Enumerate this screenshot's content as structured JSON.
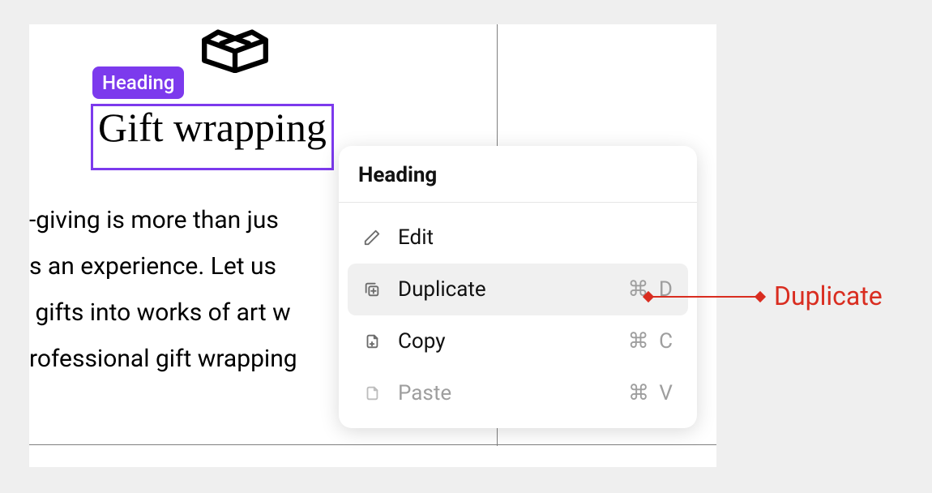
{
  "badge_label": "Heading",
  "heading_text": "Gift wrapping",
  "paragraph_line1": "-giving is more than jus",
  "paragraph_line2": "s an experience. Let us ",
  "paragraph_line3": " gifts into works of art w",
  "paragraph_line4": "rofessional gift wrapping",
  "menu": {
    "title": "Heading",
    "items": [
      {
        "label": "Edit",
        "shortcut": "",
        "icon": "pencil-icon",
        "state": "normal"
      },
      {
        "label": "Duplicate",
        "shortcut": "⌘ D",
        "icon": "duplicate-icon",
        "state": "hover"
      },
      {
        "label": "Copy",
        "shortcut": "⌘ C",
        "icon": "copy-icon",
        "state": "normal"
      },
      {
        "label": "Paste",
        "shortcut": "⌘ V",
        "icon": "paste-icon",
        "state": "disabled"
      }
    ]
  },
  "callout_label": "Duplicate"
}
